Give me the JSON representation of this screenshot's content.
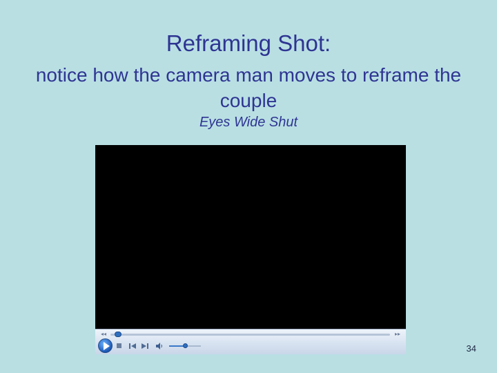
{
  "slide": {
    "title": "Reframing Shot:",
    "subtitle": "notice how the camera man moves to reframe the couple",
    "caption": "Eyes Wide Shut",
    "page_number": "34"
  },
  "player": {
    "seek_back_glyph": "◂◂",
    "seek_forward_glyph": "▸▸",
    "seek_progress": 0.02,
    "volume_level": 0.5,
    "icons": {
      "play": "play-icon",
      "stop": "stop-icon",
      "previous": "previous-icon",
      "next": "next-icon",
      "volume": "speaker-icon"
    }
  },
  "colors": {
    "background": "#b9dfe3",
    "text": "#2e3592",
    "accent": "#2f6fbf"
  }
}
